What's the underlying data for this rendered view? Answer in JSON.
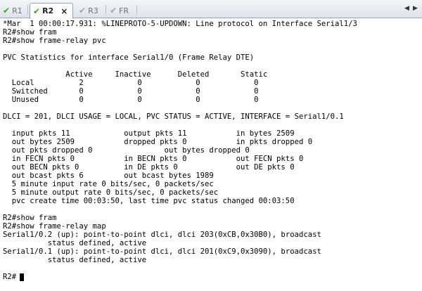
{
  "tabs": [
    {
      "label": "R1",
      "active": false,
      "check": "check-icon",
      "color": "#3aa52a"
    },
    {
      "label": "R2",
      "active": true,
      "check": "check-icon",
      "close": "×",
      "color": "#3aa52a"
    },
    {
      "label": "R3",
      "active": false,
      "check": "check-icon",
      "color": "#9aa7b5"
    },
    {
      "label": "FR",
      "active": false,
      "check": "check-icon",
      "color": "#9aa7b5"
    }
  ],
  "nav": {
    "left": "◀",
    "right": "▶"
  },
  "terminal": {
    "lines": [
      "*Mar  1 00:00:17.931: %LINEPROTO-5-UPDOWN: Line protocol on Interface Serial1/3",
      "R2#show fram",
      "R2#show frame-relay pvc",
      "",
      "PVC Statistics for interface Serial1/0 (Frame Relay DTE)",
      "",
      "              Active     Inactive      Deleted       Static",
      "  Local          2            0            0            0",
      "  Switched       0            0            0            0",
      "  Unused         0            0            0            0",
      "",
      "DLCI = 201, DLCI USAGE = LOCAL, PVC STATUS = ACTIVE, INTERFACE = Serial1/0.1",
      "",
      "  input pkts 11            output pkts 11           in bytes 2509",
      "  out bytes 2509           dropped pkts 0           in pkts dropped 0",
      "  out pkts dropped 0                out bytes dropped 0",
      "  in FECN pkts 0           in BECN pkts 0           out FECN pkts 0",
      "  out BECN pkts 0          in DE pkts 0             out DE pkts 0",
      "  out bcast pkts 6         out bcast bytes 1989",
      "  5 minute input rate 0 bits/sec, 0 packets/sec",
      "  5 minute output rate 0 bits/sec, 0 packets/sec",
      "  pvc create time 00:03:50, last time pvc status changed 00:03:50",
      "",
      "R2#show fram",
      "R2#show frame-relay map",
      "Serial1/0.2 (up): point-to-point dlci, dlci 203(0xCB,0x30B0), broadcast",
      "          status defined, active",
      "Serial1/0.1 (up): point-to-point dlci, dlci 201(0xC9,0x3090), broadcast",
      "          status defined, active",
      "",
      "R2#"
    ]
  }
}
